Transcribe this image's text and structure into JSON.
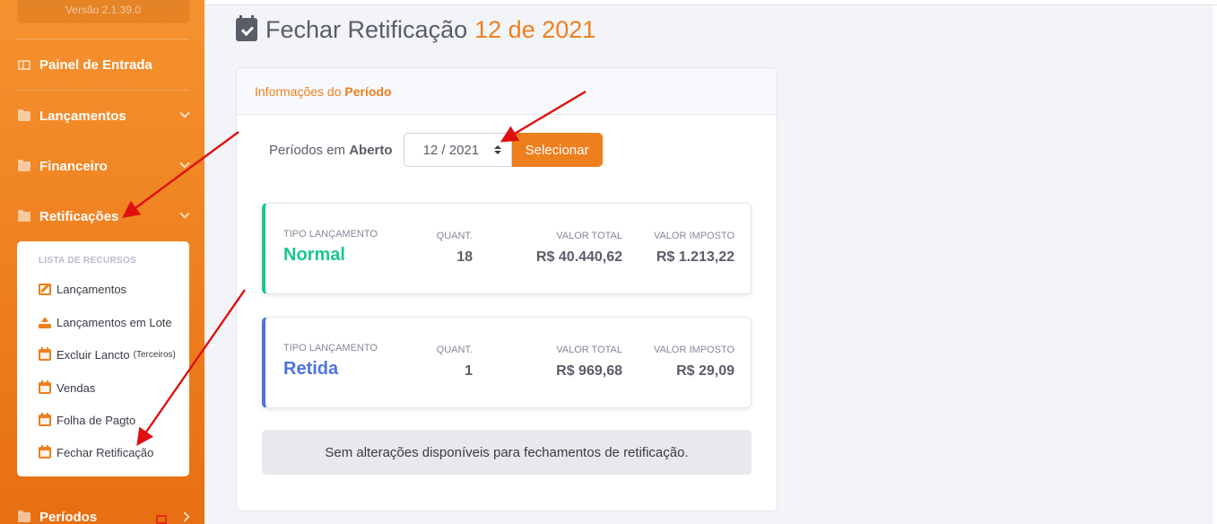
{
  "sidebar": {
    "version": "Versão 2.1.39.0",
    "items": [
      {
        "label": "Painel de Entrada"
      },
      {
        "label": "Lançamentos"
      },
      {
        "label": "Financeiro"
      },
      {
        "label": "Retificações"
      },
      {
        "label": "Períodos"
      }
    ],
    "submenu": {
      "heading": "LISTA DE RECURSOS",
      "items": [
        {
          "label": "Lançamentos",
          "icon": "edit-icon"
        },
        {
          "label": "Lançamentos em Lote",
          "icon": "upload-icon"
        },
        {
          "label": "Excluir Lancto",
          "suffix": "(Terceiros)",
          "icon": "calendar-x-icon"
        },
        {
          "label": "Vendas",
          "icon": "calendar-plus-icon"
        },
        {
          "label": "Folha de Pagto",
          "icon": "calendar-plus-icon"
        },
        {
          "label": "Fechar Retificação",
          "icon": "calendar-check-icon"
        }
      ]
    }
  },
  "page": {
    "title": "Fechar Retificação",
    "title_highlight": "12 de 2021"
  },
  "card": {
    "header_prefix": "Informações do",
    "header_bold": "Período",
    "period_label_prefix": "Períodos em",
    "period_label_bold": "Aberto",
    "period_value": "12 / 2021",
    "select_button": "Selecionar"
  },
  "summary": [
    {
      "tipo_label": "TIPO LANÇAMENTO",
      "tipo": "Normal",
      "quant_label": "QUANT.",
      "quant": "18",
      "total_label": "VALOR TOTAL",
      "total": "R$ 40.440,62",
      "imposto_label": "VALOR IMPOSTO",
      "imposto": "R$ 1.213,22"
    },
    {
      "tipo_label": "TIPO LANÇAMENTO",
      "tipo": "Retida",
      "quant_label": "QUANT.",
      "quant": "1",
      "total_label": "VALOR TOTAL",
      "total": "R$ 969,68",
      "imposto_label": "VALOR IMPOSTO",
      "imposto": "R$ 29,09"
    }
  ],
  "alert": "Sem alterações disponíveis para fechamentos de retificação.",
  "colors": {
    "accent": "#ee7f1e",
    "normal": "#1cc88a",
    "retida": "#4e73df",
    "annotation_arrow": "#e01010"
  }
}
